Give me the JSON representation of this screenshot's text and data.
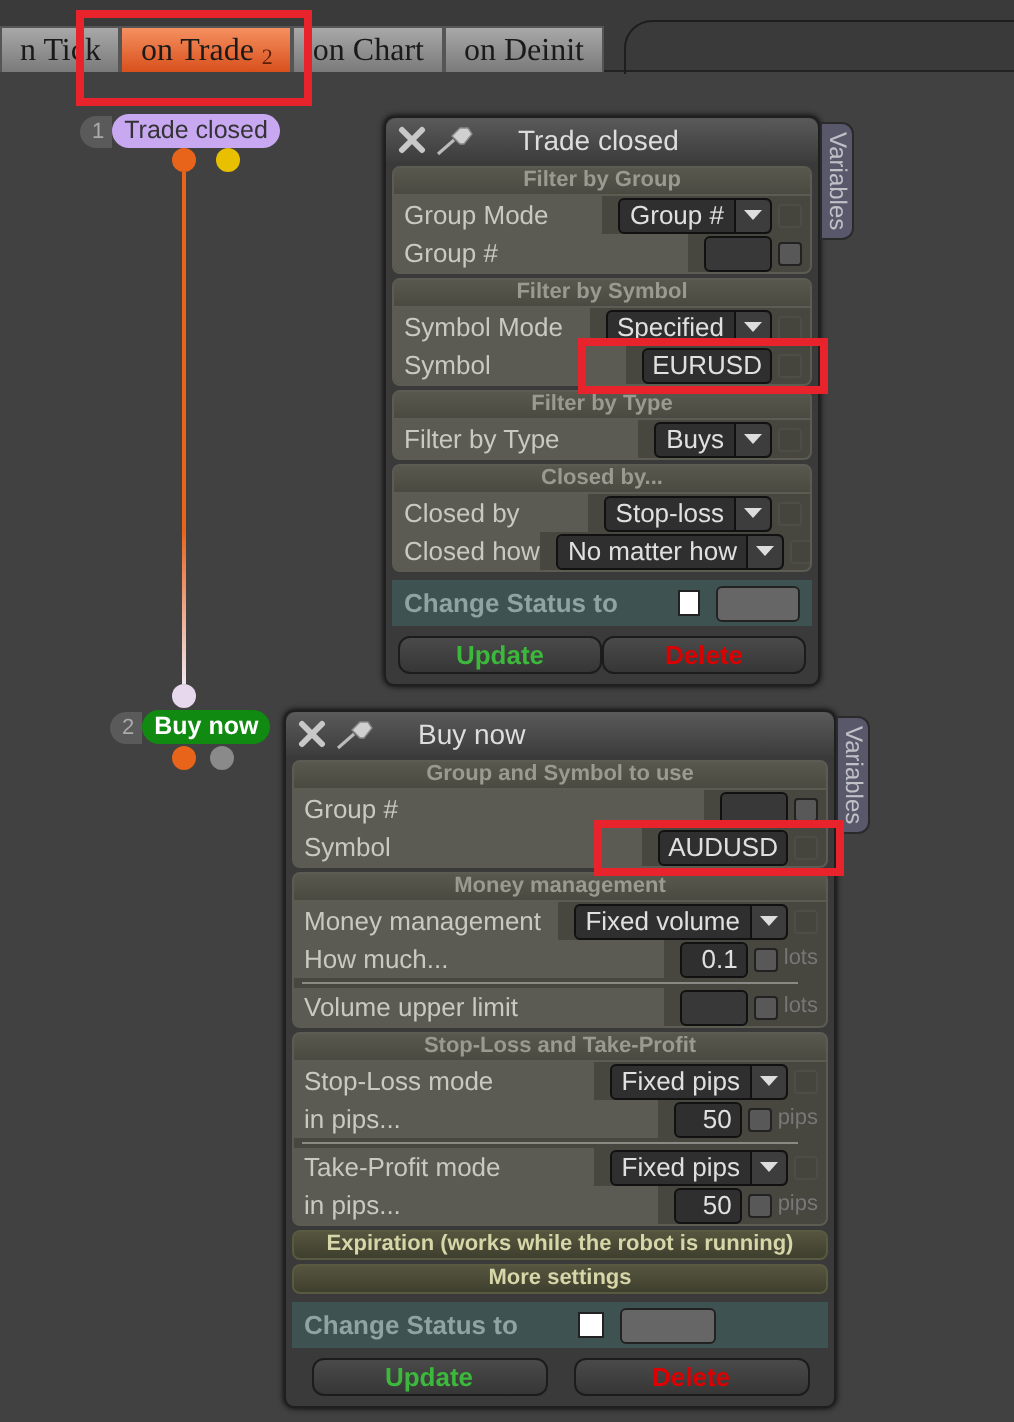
{
  "tabs": [
    {
      "label": "n Tick",
      "selected": false
    },
    {
      "label": "on Trade $_{2}$",
      "selected": true,
      "highlighted": true
    },
    {
      "label": "on Chart",
      "selected": false
    },
    {
      "label": "on Deinit",
      "selected": false
    }
  ],
  "nodes": [
    {
      "number": "1",
      "label": "Trade closed",
      "color": "#c9a8f2"
    },
    {
      "number": "2",
      "label": "Buy now",
      "color": "#108a10"
    }
  ],
  "windows": [
    {
      "title": "Trade closed",
      "side_tab": "Variables",
      "sections": [
        {
          "title": "Filter by Group",
          "expanded": true,
          "rows": [
            {
              "kind": "select",
              "label": "Group Mode",
              "value": "Group #",
              "check_disabled": true
            },
            {
              "kind": "input",
              "label": "Group #",
              "check_disabled": false
            }
          ]
        },
        {
          "title": "Filter by Symbol",
          "expanded": true,
          "rows": [
            {
              "kind": "select",
              "label": "Symbol Mode",
              "value": "Specified",
              "check_disabled": true
            },
            {
              "kind": "input",
              "label": "Symbol",
              "value": "EURUSD",
              "check_disabled": true,
              "highlighted": true
            }
          ]
        },
        {
          "title": "Filter by Type",
          "expanded": true,
          "rows": [
            {
              "kind": "select",
              "label": "Filter by Type",
              "value": "Buys",
              "check_disabled": true
            }
          ]
        },
        {
          "title": "Closed by...",
          "expanded": true,
          "rows": [
            {
              "kind": "select",
              "label": "Closed by",
              "value": "Stop-loss",
              "check_disabled": true
            },
            {
              "kind": "select",
              "label": "Closed how",
              "value": "No matter how",
              "check_disabled": true
            }
          ]
        }
      ],
      "status": {
        "label": "Change Status to",
        "checked": false
      },
      "buttons": [
        {
          "label": "Update",
          "kind": "update"
        },
        {
          "label": "Delete",
          "kind": "delete"
        }
      ]
    },
    {
      "title": "Buy now",
      "side_tab": "Variables",
      "sections": [
        {
          "title": "Group and Symbol to use",
          "expanded": true,
          "rows": [
            {
              "kind": "input",
              "label": "Group #",
              "check_disabled": false
            },
            {
              "kind": "input",
              "label": "Symbol",
              "value": "AUDUSD",
              "check_disabled": true,
              "highlighted": true
            }
          ]
        },
        {
          "title": "Money management",
          "expanded": true,
          "rows": [
            {
              "kind": "select",
              "label": "Money management",
              "value": "Fixed volume",
              "check_disabled": true
            },
            {
              "kind": "input",
              "label": "How much...",
              "value": "0.1",
              "unit": "lots",
              "check_disabled": false
            },
            {
              "kind": "input",
              "label": "Volume upper limit",
              "unit": "lots",
              "check_disabled": false,
              "divider_before": true
            }
          ]
        },
        {
          "title": "Stop-Loss and Take-Profit",
          "expanded": true,
          "rows": [
            {
              "kind": "select",
              "label": "Stop-Loss mode",
              "value": "Fixed pips",
              "check_disabled": true
            },
            {
              "kind": "input",
              "label": "in pips...",
              "value": "50",
              "unit": "pips",
              "check_disabled": false
            },
            {
              "kind": "select",
              "label": "Take-Profit mode",
              "value": "Fixed pips",
              "check_disabled": true,
              "divider_before": true
            },
            {
              "kind": "input",
              "label": "in pips...",
              "value": "50",
              "unit": "pips",
              "check_disabled": false
            }
          ]
        },
        {
          "title": "Expiration (works while the robot is running)",
          "expanded": false
        },
        {
          "title": "More settings",
          "expanded": false
        }
      ],
      "status": {
        "label": "Change Status to",
        "checked": false
      },
      "buttons": [
        {
          "label": "Update",
          "kind": "update"
        },
        {
          "label": "Delete",
          "kind": "delete"
        }
      ]
    }
  ]
}
